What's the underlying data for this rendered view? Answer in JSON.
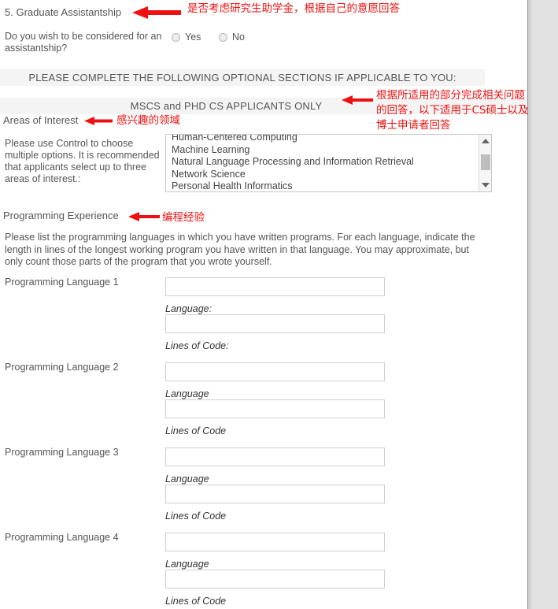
{
  "section5": {
    "title": "5. Graduate Assistantship",
    "question": "Do you wish to be considered for an assistantship?",
    "options": [
      {
        "label": "Yes",
        "selected": false
      },
      {
        "label": "No",
        "selected": false
      }
    ],
    "annotation": "是否考虑研究生助学金，根据自己的意愿回答"
  },
  "banners": {
    "optional_sections": "PLEASE COMPLETE THE FOLLOWING OPTIONAL SECTIONS IF APPLICABLE TO YOU:",
    "mscs_phd_only": "MSCS and PHD CS APPLICANTS ONLY",
    "mscs_annotation": "根据所适用的部分完成相关问题\n的回答，以下适用于CS硕士以及\n博士申请者回答"
  },
  "areas_of_interest": {
    "title": "Areas of Interest",
    "annotation": "感兴趣的领域",
    "instructions": "Please use Control to choose multiple options. It is recommended that applicants select up to three areas of interest.:",
    "options": [
      "Human-Centered Computing",
      "Machine Learning",
      "Natural Language Processing and Information Retrieval",
      "Network Science",
      "Personal Health Informatics"
    ],
    "scrollbar": {
      "up_arrow": "scroll-up-arrow",
      "down_arrow": "scroll-down-arrow",
      "thumb": "scroll-thumb"
    }
  },
  "programming_experience": {
    "title": "Programming Experience",
    "annotation": "编程经验",
    "instructions": "Please list the programming languages in which you have written programs. For each language, indicate the length in lines of the longest working program you have written in that language. You may approximate, but only count those parts of the program that you wrote yourself.",
    "entries": [
      {
        "row_label": "Programming Language 1",
        "language_caption": "Language:",
        "lines_caption": "Lines of Code:",
        "language_value": "",
        "lines_value": ""
      },
      {
        "row_label": "Programming Language 2",
        "language_caption": "Language",
        "lines_caption": "Lines of Code",
        "language_value": "",
        "lines_value": ""
      },
      {
        "row_label": "Programming Language 3",
        "language_caption": "Language",
        "lines_caption": "Lines of Code",
        "language_value": "",
        "lines_value": ""
      },
      {
        "row_label": "Programming Language 4",
        "language_caption": "Language",
        "lines_caption": "Lines of Code",
        "language_value": "",
        "lines_value": ""
      }
    ]
  },
  "colors": {
    "annotation_red": "#ee1111",
    "banner_bg": "#f4f4f4",
    "text": "#555555",
    "panel_bg": "#e2e2e2"
  }
}
